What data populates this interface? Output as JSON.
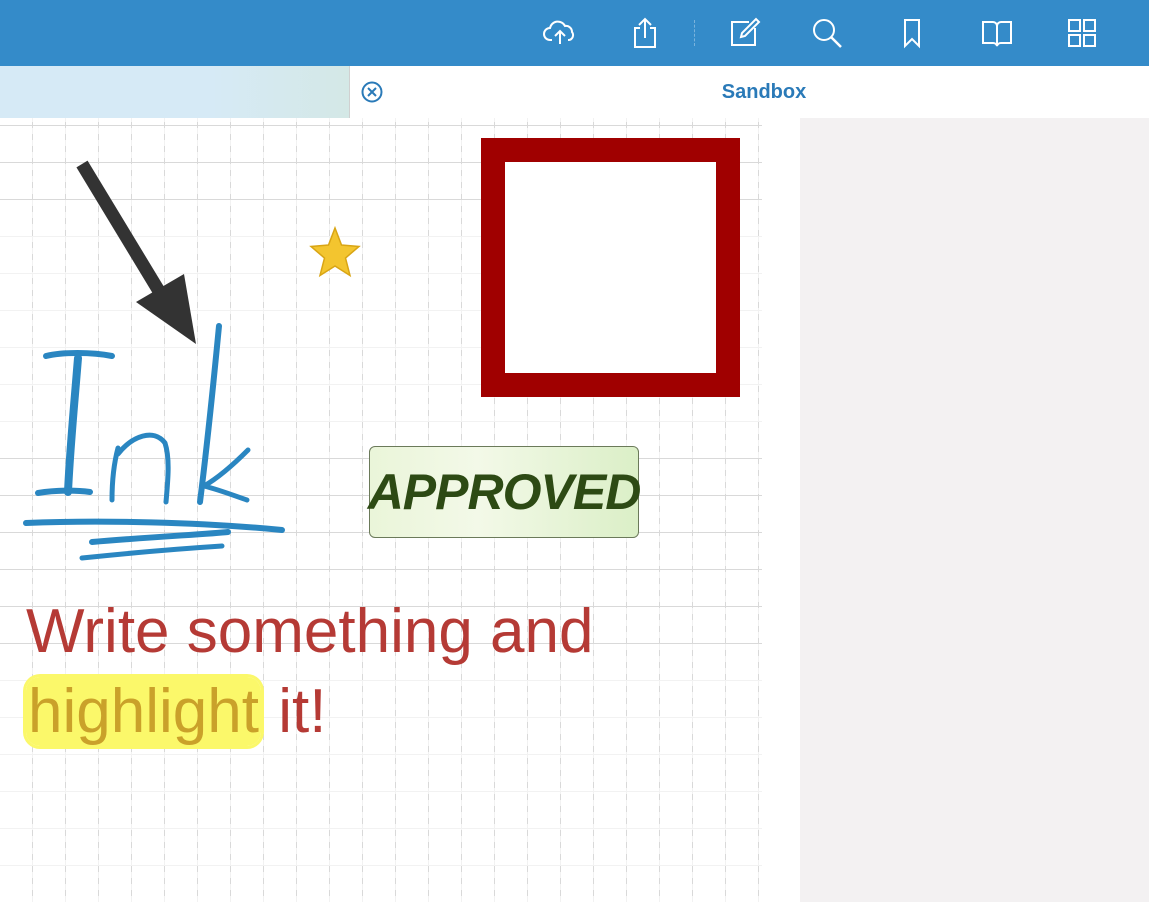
{
  "toolbar": {
    "buttons": [
      {
        "name": "cloud-upload-icon"
      },
      {
        "name": "share-icon"
      },
      {
        "name": "edit-icon"
      },
      {
        "name": "search-icon"
      },
      {
        "name": "bookmark-icon"
      },
      {
        "name": "book-icon"
      },
      {
        "name": "grid-icon"
      }
    ],
    "bg_color": "#348bc9"
  },
  "tabs": {
    "active_title": "Sandbox"
  },
  "document": {
    "stamp_text": "APPROVED",
    "text_line1": "Write something and",
    "text_highlight": "highlight",
    "text_rest": " it!",
    "colors": {
      "ink_blue": "#2a86c1",
      "arrow": "#333333",
      "square_border": "#a00000",
      "text_red": "#b53a35",
      "highlight": "#fbf86a",
      "star": "#f3c52f"
    }
  }
}
